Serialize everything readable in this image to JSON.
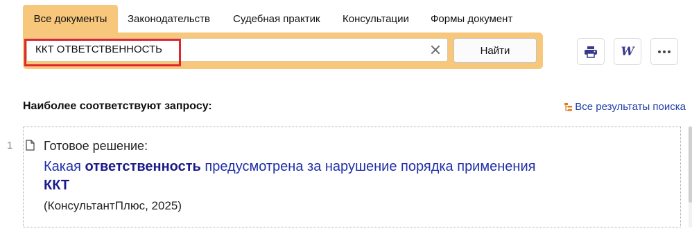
{
  "tabs": [
    {
      "label": "Все документы",
      "active": true
    },
    {
      "label": "Законодательств",
      "active": false
    },
    {
      "label": "Судебная практик",
      "active": false
    },
    {
      "label": "Консультации",
      "active": false
    },
    {
      "label": "Формы документ",
      "active": false
    }
  ],
  "search": {
    "query": "ККТ ОТВЕТСТВЕННОСТЬ",
    "find_label": "Найти"
  },
  "toolbar": {
    "print_icon": "printer-icon",
    "word_icon": "word-export-icon",
    "word_glyph": "W",
    "more_icon": "more-dots-icon"
  },
  "results": {
    "heading": "Наиболее соответствуют запросу:",
    "all_results_label": "Все результаты поиска",
    "items": [
      {
        "number": "1",
        "type": "Готовое решение:",
        "title_part1": "Какая ",
        "title_bold1": "ответственность",
        "title_part2": " предусмотрена за нарушение порядка применения ",
        "title_bold2": "ККТ",
        "source": "(КонсультантПлюс, 2025)"
      }
    ]
  },
  "colors": {
    "accent": "#f7c77b",
    "link": "#1f2fa8",
    "highlight_border": "#e0262b"
  }
}
